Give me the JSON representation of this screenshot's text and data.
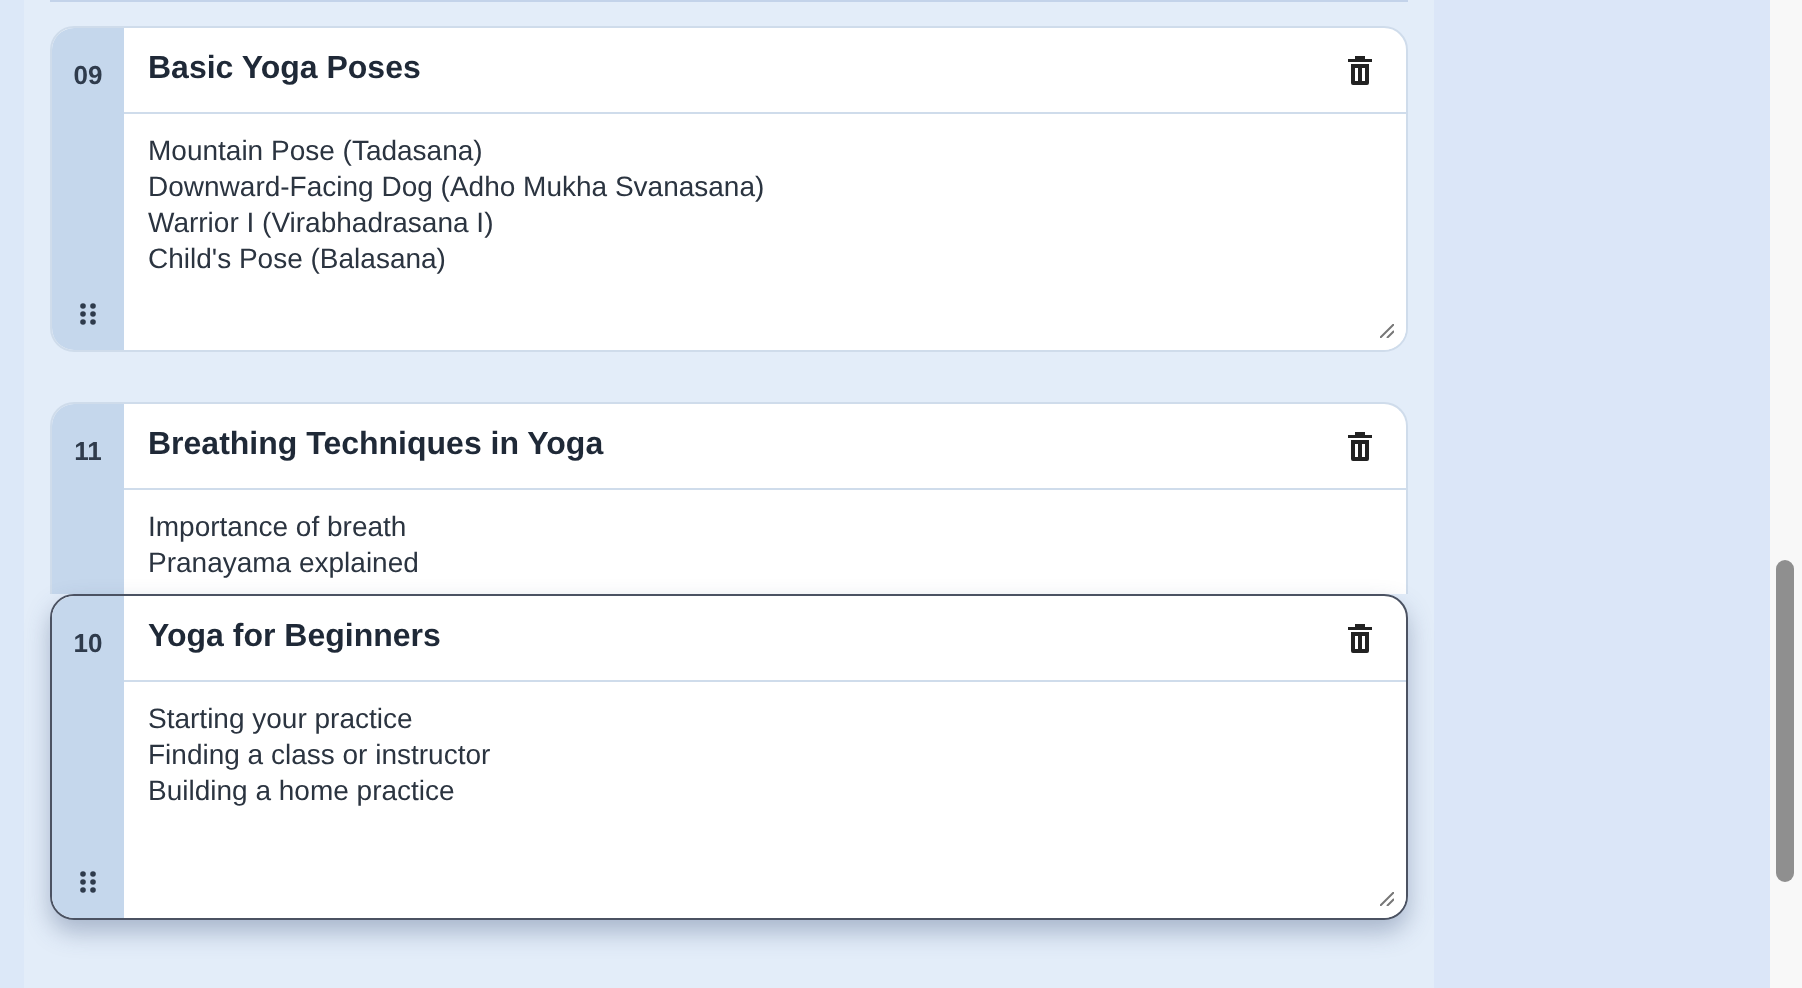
{
  "lessons": [
    {
      "number": "09",
      "title": "Basic Yoga Poses",
      "lines": [
        "Mountain Pose (Tadasana)",
        "Downward-Facing Dog (Adho Mukha Svanasana)",
        "Warrior I (Virabhadrasana I)",
        "Child's Pose (Balasana)"
      ],
      "dragging": false
    },
    {
      "number": "11",
      "title": "Breathing Techniques in Yoga",
      "lines": [
        "Importance of breath",
        "Pranayama explained"
      ],
      "dragging": false
    },
    {
      "number": "10",
      "title": "Yoga for Beginners",
      "lines": [
        "Starting your practice",
        "Finding a class or instructor",
        "Building a home practice"
      ],
      "dragging": true
    }
  ]
}
